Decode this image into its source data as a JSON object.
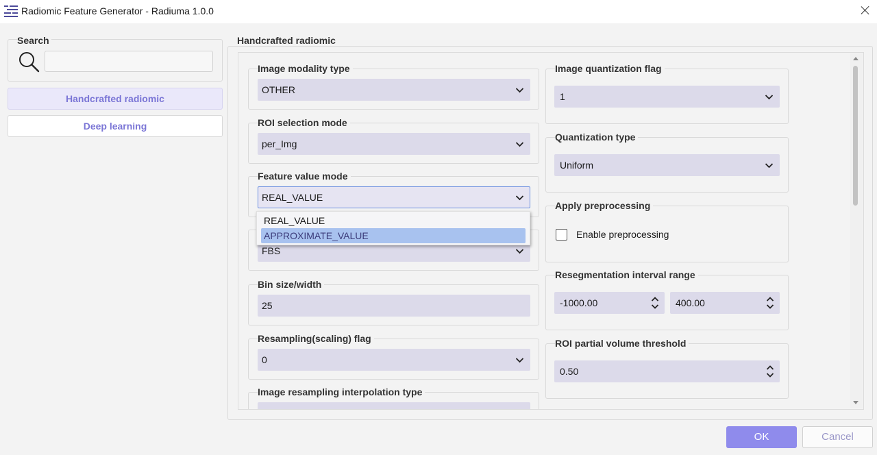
{
  "window": {
    "title": "Radiomic Feature Generator - Radiuma 1.0.0"
  },
  "sidebar": {
    "search_label": "Search",
    "search_value": "",
    "items": [
      {
        "label": "Handcrafted radiomic",
        "active": true
      },
      {
        "label": "Deep learning",
        "active": false
      }
    ]
  },
  "main": {
    "group_title": "Handcrafted radiomic",
    "left_fields": {
      "modality": {
        "label": "Image modality type",
        "value": "OTHER"
      },
      "roi_mode": {
        "label": "ROI selection mode",
        "value": "per_Img"
      },
      "feature_mode": {
        "label": "Feature value mode",
        "value": "REAL_VALUE"
      },
      "discretization": {
        "label": "",
        "value": "FBS"
      },
      "bin_size": {
        "label": "Bin size/width",
        "value": "25"
      },
      "resampling_flag": {
        "label": "Resampling(scaling) flag",
        "value": "0"
      },
      "interp_type": {
        "label": "Image resampling interpolation type",
        "value": ""
      }
    },
    "right_fields": {
      "quant_flag": {
        "label": "Image quantization flag",
        "value": "1"
      },
      "quant_type": {
        "label": "Quantization type",
        "value": "Uniform"
      },
      "preprocessing": {
        "label": "Apply preprocessing",
        "checkbox_label": "Enable preprocessing",
        "checked": false
      },
      "reseg": {
        "label": "Resegmentation interval range",
        "min": "-1000.00",
        "max": "400.00"
      },
      "roi_pv": {
        "label": "ROI partial volume threshold",
        "value": "0.50"
      }
    },
    "dropdown_options": [
      "REAL_VALUE",
      "APPROXIMATE_VALUE"
    ],
    "dropdown_highlighted": "APPROXIMATE_VALUE"
  },
  "footer": {
    "ok_label": "OK",
    "cancel_label": "Cancel"
  },
  "colors": {
    "accent": "#8f8bec",
    "field_bg": "#dcdaea",
    "highlight": "#a8c2ef"
  }
}
